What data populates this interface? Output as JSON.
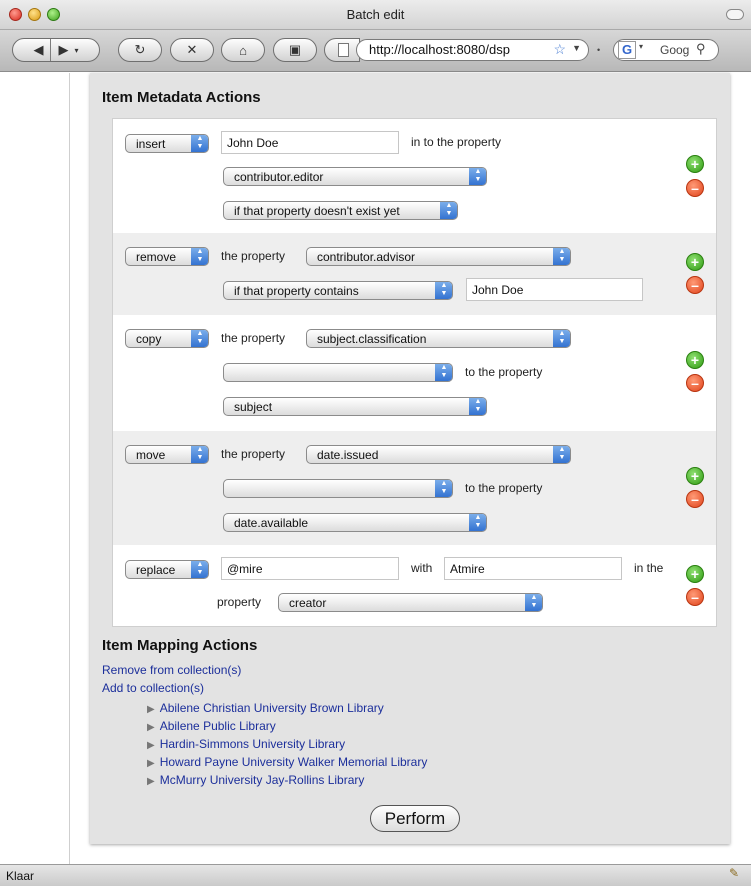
{
  "window": {
    "title": "Batch edit"
  },
  "toolbar": {
    "url": "http://localhost:8080/dsp",
    "search_placeholder": "Goog",
    "search_engine_letter": "G"
  },
  "metadata": {
    "heading": "Item Metadata Actions",
    "rows": [
      {
        "action": "insert",
        "value": "John Doe",
        "text1": "in to the property",
        "property": "contributor.editor",
        "condition": "if that property doesn't exist yet"
      },
      {
        "action": "remove",
        "text1": "the property",
        "property": "contributor.advisor",
        "condition": "if that property contains",
        "value": "John Doe"
      },
      {
        "action": "copy",
        "text1": "the property",
        "property": "subject.classification",
        "qualifier": "",
        "text2": "to the property",
        "target": "subject"
      },
      {
        "action": "move",
        "text1": "the property",
        "property": "date.issued",
        "qualifier": "",
        "text2": "to the property",
        "target": "date.available"
      },
      {
        "action": "replace",
        "value": "@mire",
        "text1": "with",
        "value2": "Atmire",
        "text2": "in the",
        "text3": "property",
        "property": "creator"
      }
    ],
    "add_symbol": "+",
    "remove_symbol": "–"
  },
  "mapping": {
    "heading": "Item Mapping Actions",
    "remove_link": "Remove from collection(s)",
    "add_link": "Add to collection(s)",
    "collections": [
      "Abilene Christian University Brown Library",
      "Abilene Public Library",
      "Hardin-Simmons University Library",
      "Howard Payne University Walker Memorial Library",
      "McMurry University Jay-Rollins Library"
    ]
  },
  "perform_label": "Perform",
  "status": {
    "text": "Klaar"
  },
  "colors": {
    "link": "#1c2f9b",
    "add": "#2f9a12",
    "remove": "#e0431b",
    "select_arrow": "#2f6fd0"
  }
}
